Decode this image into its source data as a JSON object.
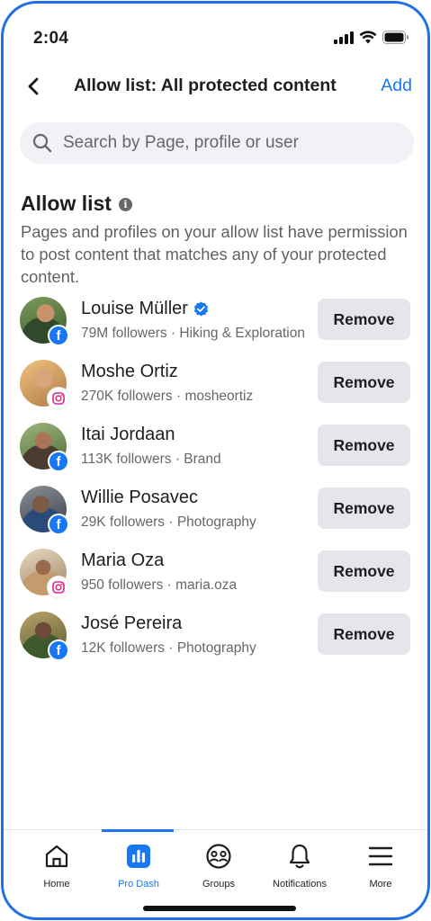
{
  "status_bar": {
    "time": "2:04"
  },
  "header": {
    "title": "Allow list: All protected content",
    "add_label": "Add"
  },
  "search": {
    "placeholder": "Search by Page, profile or user"
  },
  "section": {
    "title": "Allow list",
    "description": "Pages and profiles on your allow list have permission to post content that matches any of your protected content."
  },
  "items": [
    {
      "name": "Louise Müller",
      "meta": "79M followers · Hiking & Exploration",
      "platform": "facebook",
      "verified": true,
      "remove_label": "Remove"
    },
    {
      "name": "Moshe Ortiz",
      "meta": "270K followers · mosheortiz",
      "platform": "instagram",
      "verified": false,
      "remove_label": "Remove"
    },
    {
      "name": "Itai Jordaan",
      "meta": "113K followers · Brand",
      "platform": "facebook",
      "verified": false,
      "remove_label": "Remove"
    },
    {
      "name": "Willie Posavec",
      "meta": "29K followers · Photography",
      "platform": "facebook",
      "verified": false,
      "remove_label": "Remove"
    },
    {
      "name": "Maria Oza",
      "meta": "950 followers · maria.oza",
      "platform": "instagram",
      "verified": false,
      "remove_label": "Remove"
    },
    {
      "name": "José Pereira",
      "meta": "12K followers · Photography",
      "platform": "facebook",
      "verified": false,
      "remove_label": "Remove"
    }
  ],
  "bottom_nav": {
    "items": [
      {
        "label": "Home",
        "icon": "home-icon",
        "active": false
      },
      {
        "label": "Pro Dash",
        "icon": "bar-chart-icon",
        "active": true
      },
      {
        "label": "Groups",
        "icon": "groups-icon",
        "active": false
      },
      {
        "label": "Notifications",
        "icon": "bell-icon",
        "active": false
      },
      {
        "label": "More",
        "icon": "menu-icon",
        "active": false
      }
    ]
  },
  "colors": {
    "accent": "#1877f2",
    "frame": "#1f6fe8",
    "button_bg": "#e4e6eb",
    "muted_text": "#65676b"
  }
}
